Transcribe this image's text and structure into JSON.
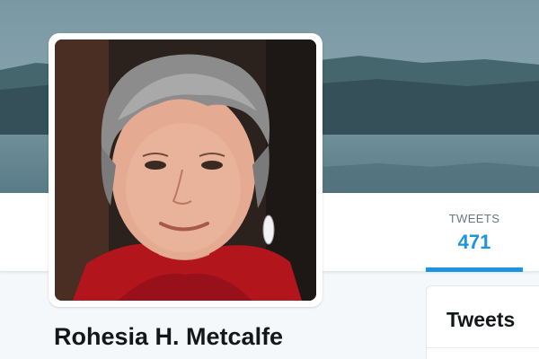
{
  "profile": {
    "name": "Rohesia H. Metcalfe"
  },
  "nav": {
    "stats": [
      {
        "label": "TWEETS",
        "value": "471"
      }
    ]
  },
  "sidebar_card": {
    "title": "Tweets"
  },
  "colors": {
    "accent": "#1b95e0",
    "text_primary": "#14171a",
    "text_secondary": "#657786",
    "page_background": "#f5f8fa"
  }
}
